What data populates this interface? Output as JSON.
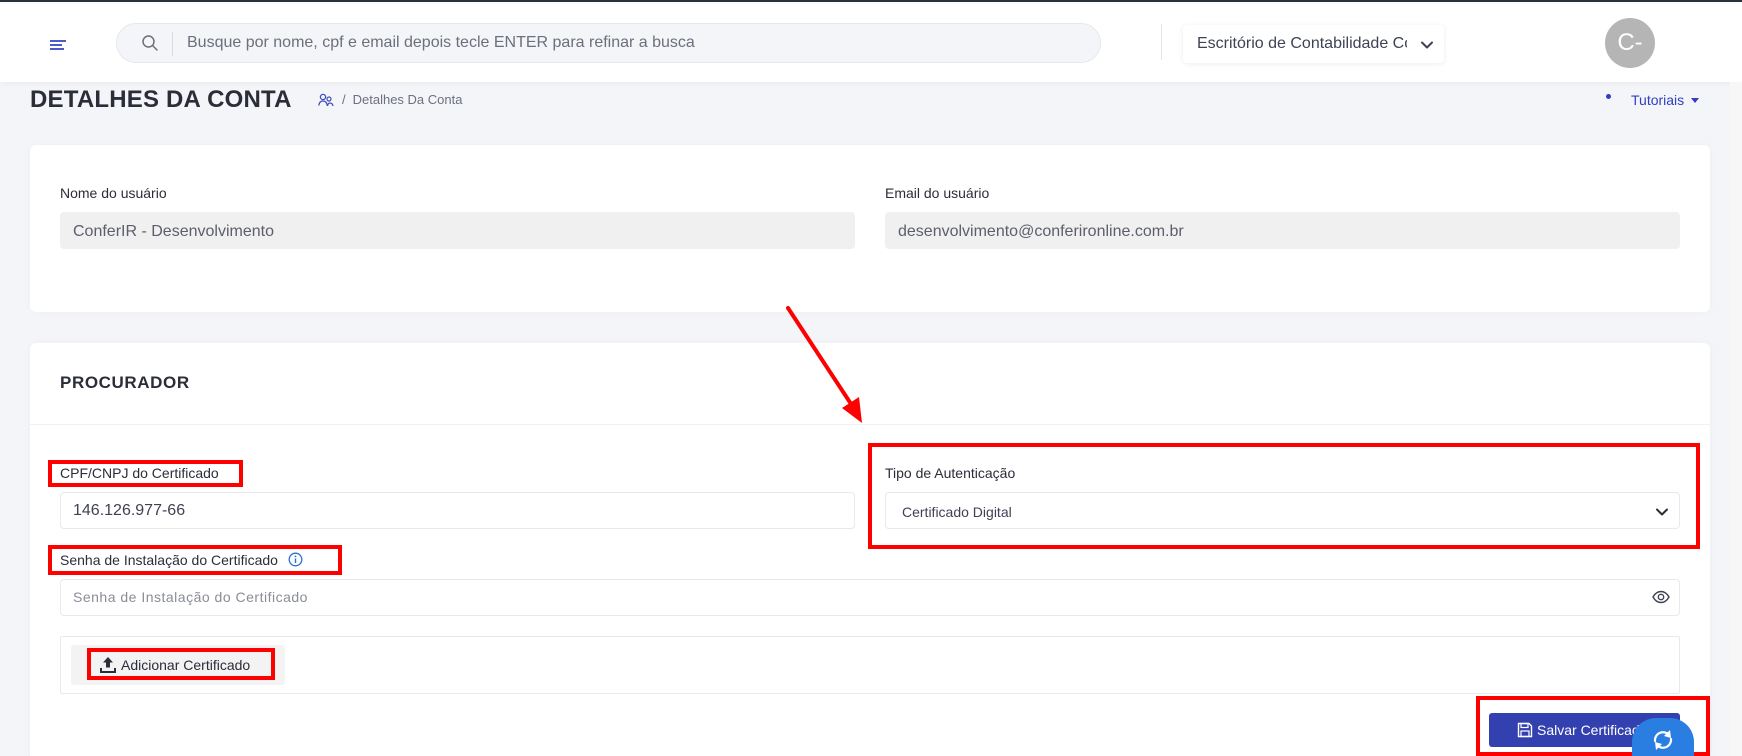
{
  "header": {
    "search_placeholder": "Busque por nome, cpf e email depois tecle ENTER para refinar a busca",
    "office_selector": "Escritório de Contabilidade Conf",
    "avatar_initials": "C-"
  },
  "page": {
    "title": "DETALHES DA CONTA",
    "breadcrumb_separator": "/",
    "breadcrumb_current": "Detalhes Da Conta",
    "tutorials_label": "Tutoriais"
  },
  "account": {
    "username_label": "Nome do usuário",
    "username_value": "ConferIR - Desenvolvimento",
    "email_label": "Email do usuário",
    "email_value": "desenvolvimento@conferironline.com.br"
  },
  "procurador": {
    "section_title": "PROCURADOR",
    "cpf_label": "CPF/CNPJ do Certificado",
    "cpf_value": "146.126.977-66",
    "auth_label": "Tipo de Autenticação",
    "auth_value": "Certificado Digital",
    "password_label": "Senha de Instalação do Certificado",
    "password_placeholder": "Senha de Instalação do Certificado",
    "add_certificate_label": "Adicionar Certificado",
    "save_certificate_label": "Salvar Certificado"
  },
  "colors": {
    "accent": "#3340b0",
    "link": "#2f3ec3",
    "highlight": "#ff0000",
    "background": "#f4f5f8"
  },
  "icons": [
    "menu-icon",
    "search-icon",
    "chevron-down-icon",
    "users-icon",
    "info-icon",
    "eye-icon",
    "upload-icon",
    "save-icon",
    "refresh-icon"
  ]
}
